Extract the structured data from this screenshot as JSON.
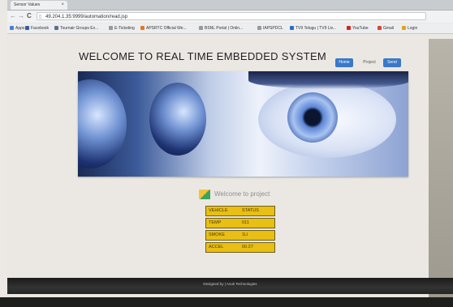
{
  "browser": {
    "tab_title": "Sensor Values",
    "tab_close": "×",
    "back_glyph": "←",
    "forward_glyph": "→",
    "reload_glyph": "C",
    "url": "49.204.1.35:9999/automation/read.jsp",
    "bookmarks": [
      {
        "label": "Apps",
        "color": "#4a7fd6"
      },
      {
        "label": "Facebook",
        "color": "#3b5998"
      },
      {
        "label": "Tournair Groups Ex...",
        "color": "#5d6f8a"
      },
      {
        "label": "E-Ticketing",
        "color": "#999999"
      },
      {
        "label": "APSRTC Official We...",
        "color": "#e07a1f"
      },
      {
        "label": "BSNL Portal | Onlin...",
        "color": "#999999"
      },
      {
        "label": "IAPSPDCL",
        "color": "#999999"
      },
      {
        "label": "TV9 Telugu | TV9 Liv...",
        "color": "#2b6cc4"
      },
      {
        "label": "YouTube",
        "color": "#d4261c"
      },
      {
        "label": "Gmail",
        "color": "#d44638"
      },
      {
        "label": "Login",
        "color": "#e3a21a"
      }
    ]
  },
  "header": {
    "title": "WELCOME TO REAL TIME EMBEDDED SYSTEM",
    "nav": {
      "home": "Home",
      "project": "Project",
      "send": "Send"
    }
  },
  "welcome": {
    "text": "Welcome to project"
  },
  "status_table": {
    "rows": [
      {
        "key": "VEHICLE",
        "value": "STATUS"
      },
      {
        "key": "TEMP",
        "value": "011"
      },
      {
        "key": "SMOKE",
        "value": "1Ll"
      },
      {
        "key": "ACCEL",
        "value": "00.27"
      }
    ]
  },
  "footer": {
    "text": "Designed by | Anok Technologies"
  },
  "colors": {
    "accent": "#3a78c9",
    "status_fill": "#e8bf12",
    "footer_bg": "#1b1b1b"
  }
}
